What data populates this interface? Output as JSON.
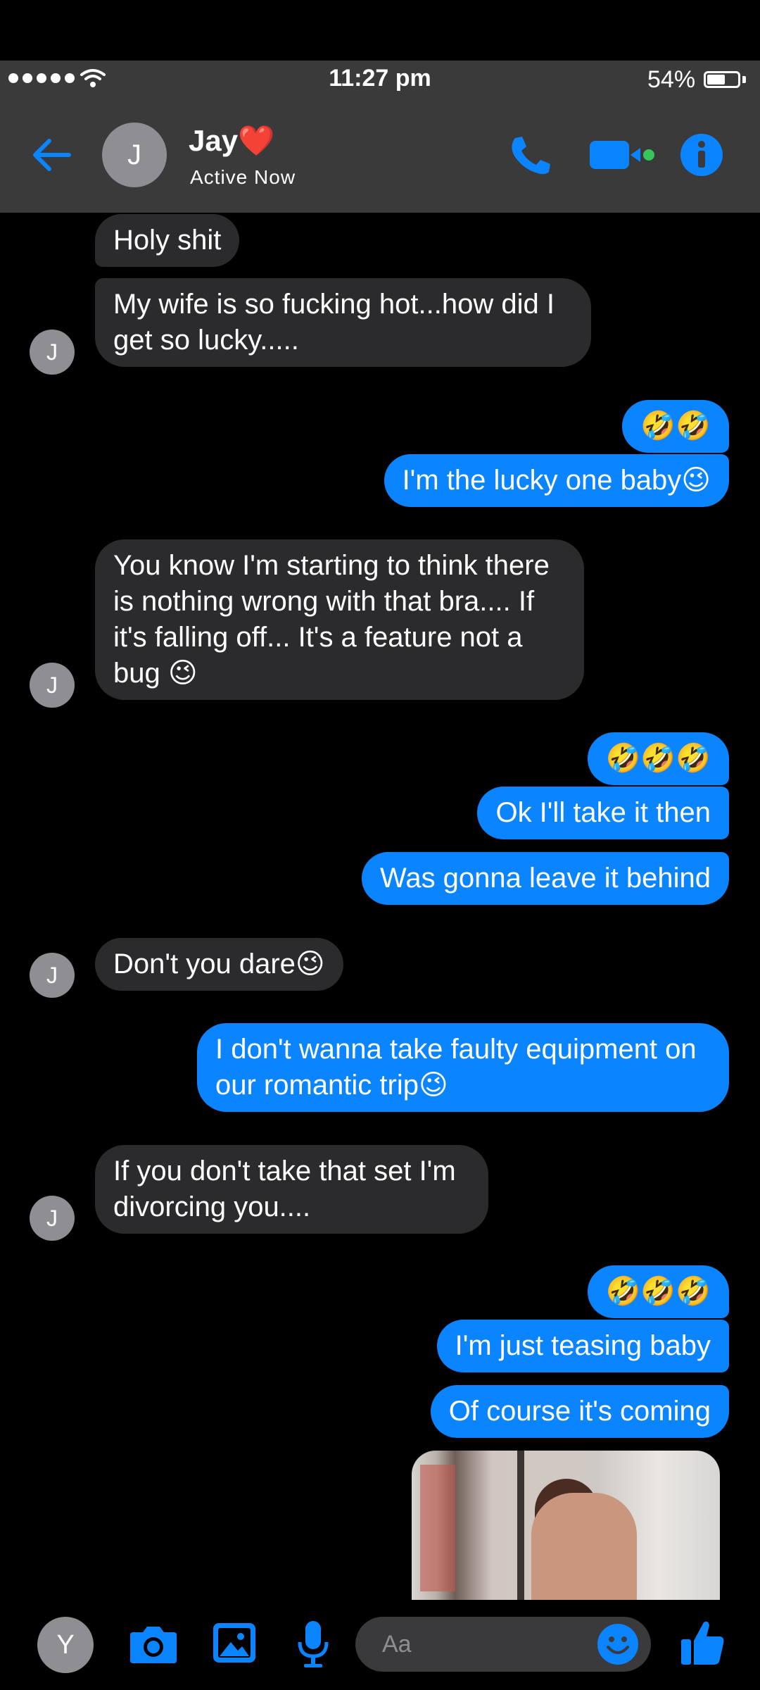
{
  "status_bar": {
    "time": "11:27 pm",
    "battery_percent": "54%",
    "battery_level": 0.54,
    "signal_dots": 5
  },
  "header": {
    "avatar_initial": "J",
    "contact_name": "Jay❤️",
    "contact_status": "Active Now"
  },
  "messages": [
    {
      "side": "in",
      "text": "Holy shit"
    },
    {
      "side": "in",
      "text": "My wife is so fucking hot...how did I get so lucky.....",
      "avatar_initial": "J"
    },
    {
      "side": "out",
      "text": "🤣🤣"
    },
    {
      "side": "out",
      "text": "I'm the lucky one baby😉"
    },
    {
      "side": "in",
      "text": "You know I'm starting to think there is nothing wrong with that bra.... If it's falling off... It's a feature not a bug 😉",
      "avatar_initial": "J"
    },
    {
      "side": "out",
      "text": "🤣🤣🤣"
    },
    {
      "side": "out",
      "text": "Ok I'll take it then"
    },
    {
      "side": "out",
      "text": "Was gonna leave it behind"
    },
    {
      "side": "in",
      "text": "Don't you dare😉",
      "avatar_initial": "J"
    },
    {
      "side": "out",
      "text": "I don't wanna take faulty equipment on our romantic trip😉"
    },
    {
      "side": "in",
      "text": "If you don't take that set I'm divorcing you....",
      "avatar_initial": "J"
    },
    {
      "side": "out",
      "text": "🤣🤣🤣"
    },
    {
      "side": "out",
      "text": "I'm just teasing baby"
    },
    {
      "side": "out",
      "text": "Of course it's coming"
    }
  ],
  "composer": {
    "avatar_initial": "Y",
    "placeholder": "Aa"
  },
  "colors": {
    "accent": "#0a84ff",
    "incoming_bubble": "#2b2b2e",
    "header_bg": "#3a3a3a",
    "video_dot": "#34c759"
  }
}
